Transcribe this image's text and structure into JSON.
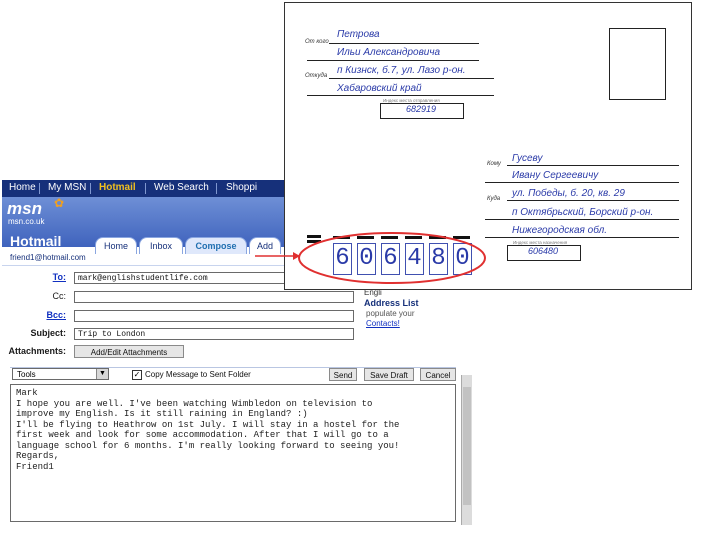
{
  "hotmail": {
    "nav": [
      "Home",
      "My MSN",
      "Hotmail",
      "Web Search",
      "Shoppi"
    ],
    "logo": "msn",
    "logo_sub": "msn.co.uk",
    "brand": "Hotmail",
    "tabs": [
      "Home",
      "Inbox",
      "Compose",
      "Add"
    ],
    "user": "friend1@hotmail.com",
    "fields": {
      "to_label": "To:",
      "to_value": "mark@englishstudentlife.com",
      "cc_label": "Cc:",
      "cc_value": "",
      "bcc_label": "Bcc:",
      "bcc_value": "",
      "subject_label": "Subject:",
      "subject_value": "Trip to London",
      "attachments_label": "Attachments:",
      "attach_button": "Add/Edit Attachments"
    },
    "toolbar": {
      "tools": "Tools",
      "copy_label": "Copy Message to Sent Folder",
      "send": "Send",
      "save_draft": "Save Draft",
      "cancel": "Cancel"
    },
    "body_lines": [
      "Mark",
      "",
      "I hope you are well. I've been watching Wimbledon on television to",
      "improve my English. Is it still raining in England? :)",
      "",
      "I'll be flying to Heathrow on 1st July. I will stay in a hostel for the",
      "first week and look for some accommodation. After that I will go to a",
      "language school for 6 months. I'm really looking forward to seeing you!",
      "",
      "Regards,",
      "Friend1"
    ],
    "side_panel": {
      "english_label": "Engli",
      "address_list": "Address List",
      "populate": "populate your",
      "contacts": "Contacts!"
    }
  },
  "envelope": {
    "from_label": "От кого",
    "from_lines": [
      "Петрова",
      "Ильи Александровича"
    ],
    "where_label": "Откуда",
    "where_lines": [
      "п Кизнск, б.7, ул. Лазо р-он.",
      "Хабаровский край"
    ],
    "sender_index_caption": "Индекс места отправления",
    "sender_index": "682919",
    "to_label": "Кому",
    "to_lines": [
      "Гусеву",
      "Ивану Сергеевичу"
    ],
    "dest_label": "Куда",
    "dest_lines": [
      "ул. Победы, б. 20, кв. 29",
      "п Октябрьский, Борский р-он.",
      "Нижегородская обл."
    ],
    "dest_index_caption": "Индекс места назначения",
    "dest_index": "606480",
    "big_index_digits": [
      "6",
      "0",
      "6",
      "4",
      "8",
      "0"
    ],
    "annotation_color": "#e03030"
  }
}
